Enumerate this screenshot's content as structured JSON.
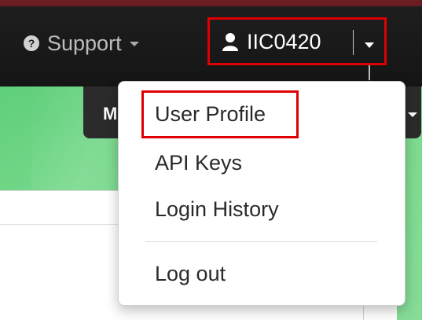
{
  "navbar": {
    "support_label": "Support",
    "username": "IIC0420",
    "support_icon": "question-circle-icon",
    "user_icon": "user-icon"
  },
  "background": {
    "tab_label": "M"
  },
  "user_menu": {
    "items": [
      {
        "label": "User Profile",
        "highlighted": true
      },
      {
        "label": "API Keys"
      },
      {
        "label": "Login History"
      },
      {
        "label": "Log out"
      }
    ]
  },
  "colors": {
    "navbar": "#1a1a1a",
    "highlight": "#e00000",
    "green_bg": "#7cdb8f"
  }
}
